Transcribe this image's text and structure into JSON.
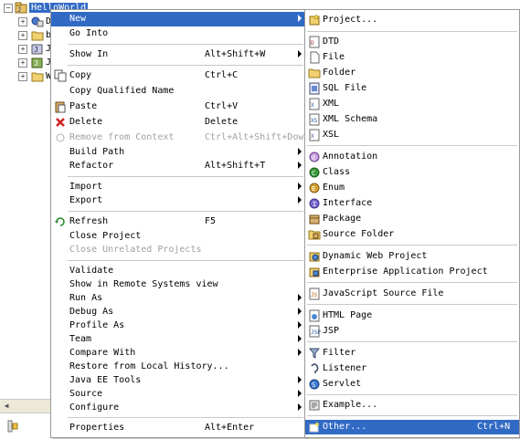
{
  "tree": {
    "items": [
      {
        "label": "HelloWorld",
        "selected": true
      },
      {
        "label": "D"
      },
      {
        "label": "b"
      },
      {
        "label": "J"
      },
      {
        "label": "J"
      },
      {
        "label": "W"
      }
    ]
  },
  "context_menu": {
    "new": {
      "label": "New"
    },
    "go_into": {
      "label": "Go Into"
    },
    "show_in": {
      "label": "Show In",
      "shortcut": "Alt+Shift+W"
    },
    "copy": {
      "label": "Copy",
      "shortcut": "Ctrl+C"
    },
    "copy_qualified": {
      "label": "Copy Qualified Name"
    },
    "paste": {
      "label": "Paste",
      "shortcut": "Ctrl+V"
    },
    "delete": {
      "label": "Delete",
      "shortcut": "Delete"
    },
    "remove_context": {
      "label": "Remove from Context",
      "shortcut": "Ctrl+Alt+Shift+Down"
    },
    "build_path": {
      "label": "Build Path"
    },
    "refactor": {
      "label": "Refactor",
      "shortcut": "Alt+Shift+T"
    },
    "import": {
      "label": "Import"
    },
    "export": {
      "label": "Export"
    },
    "refresh": {
      "label": "Refresh",
      "shortcut": "F5"
    },
    "close_project": {
      "label": "Close Project"
    },
    "close_unrelated": {
      "label": "Close Unrelated Projects"
    },
    "validate": {
      "label": "Validate"
    },
    "show_remote": {
      "label": "Show in Remote Systems view"
    },
    "run_as": {
      "label": "Run As"
    },
    "debug_as": {
      "label": "Debug As"
    },
    "profile_as": {
      "label": "Profile As"
    },
    "team": {
      "label": "Team"
    },
    "compare_with": {
      "label": "Compare With"
    },
    "restore_history": {
      "label": "Restore from Local History..."
    },
    "javaee_tools": {
      "label": "Java EE Tools"
    },
    "source": {
      "label": "Source"
    },
    "configure": {
      "label": "Configure"
    },
    "properties": {
      "label": "Properties",
      "shortcut": "Alt+Enter"
    }
  },
  "new_submenu": {
    "project": {
      "label": "Project..."
    },
    "dtd": {
      "label": "DTD"
    },
    "file": {
      "label": "File"
    },
    "folder": {
      "label": "Folder"
    },
    "sql_file": {
      "label": "SQL File"
    },
    "xml": {
      "label": "XML"
    },
    "xml_schema": {
      "label": "XML Schema"
    },
    "xsl": {
      "label": "XSL"
    },
    "annotation": {
      "label": "Annotation"
    },
    "class": {
      "label": "Class"
    },
    "enum": {
      "label": "Enum"
    },
    "interface": {
      "label": "Interface"
    },
    "package": {
      "label": "Package"
    },
    "source_folder": {
      "label": "Source Folder"
    },
    "dynamic_web": {
      "label": "Dynamic Web Project"
    },
    "enterprise_app": {
      "label": "Enterprise Application Project"
    },
    "js_source": {
      "label": "JavaScript Source File"
    },
    "html_page": {
      "label": "HTML Page"
    },
    "jsp": {
      "label": "JSP"
    },
    "filter": {
      "label": "Filter"
    },
    "listener": {
      "label": "Listener"
    },
    "servlet": {
      "label": "Servlet"
    },
    "example": {
      "label": "Example..."
    },
    "other": {
      "label": "Other...",
      "shortcut": "Ctrl+N"
    }
  },
  "colors": {
    "highlight": "#316ac5",
    "disabled_text": "#a0a0a0",
    "separator": "#c8c8c8"
  }
}
